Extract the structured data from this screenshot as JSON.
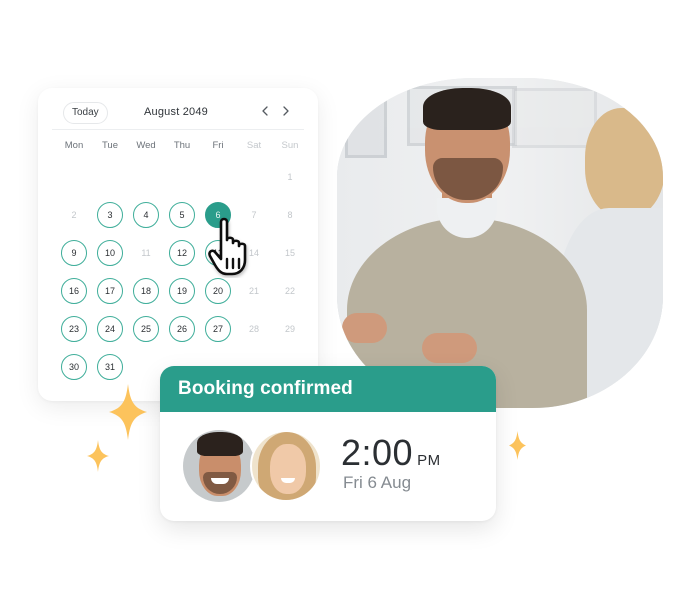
{
  "calendar": {
    "today_label": "Today",
    "month_title": "August 2049",
    "prev_icon": "chevron-left-icon",
    "next_icon": "chevron-right-icon",
    "weekdays": [
      {
        "label": "Mon",
        "weekend": false
      },
      {
        "label": "Tue",
        "weekend": false
      },
      {
        "label": "Wed",
        "weekend": false
      },
      {
        "label": "Thu",
        "weekend": false
      },
      {
        "label": "Fri",
        "weekend": false
      },
      {
        "label": "Sat",
        "weekend": true
      },
      {
        "label": "Sun",
        "weekend": true
      }
    ],
    "leading_empty_days": 6,
    "days": [
      {
        "day": "1",
        "state": "unavailable"
      },
      {
        "day": "2",
        "state": "unavailable"
      },
      {
        "day": "3",
        "state": "available"
      },
      {
        "day": "4",
        "state": "available"
      },
      {
        "day": "5",
        "state": "available"
      },
      {
        "day": "6",
        "state": "selected"
      },
      {
        "day": "7",
        "state": "unavailable"
      },
      {
        "day": "8",
        "state": "unavailable"
      },
      {
        "day": "9",
        "state": "available"
      },
      {
        "day": "10",
        "state": "available"
      },
      {
        "day": "11",
        "state": "unavailable"
      },
      {
        "day": "12",
        "state": "available"
      },
      {
        "day": "13",
        "state": "available"
      },
      {
        "day": "14",
        "state": "unavailable"
      },
      {
        "day": "15",
        "state": "unavailable"
      },
      {
        "day": "16",
        "state": "available"
      },
      {
        "day": "17",
        "state": "available"
      },
      {
        "day": "18",
        "state": "available"
      },
      {
        "day": "19",
        "state": "available"
      },
      {
        "day": "20",
        "state": "available"
      },
      {
        "day": "21",
        "state": "unavailable"
      },
      {
        "day": "22",
        "state": "unavailable"
      },
      {
        "day": "23",
        "state": "available"
      },
      {
        "day": "24",
        "state": "available"
      },
      {
        "day": "25",
        "state": "available"
      },
      {
        "day": "26",
        "state": "available"
      },
      {
        "day": "27",
        "state": "available"
      },
      {
        "day": "28",
        "state": "unavailable"
      },
      {
        "day": "29",
        "state": "unavailable"
      },
      {
        "day": "30",
        "state": "available"
      },
      {
        "day": "31",
        "state": "available"
      }
    ]
  },
  "pointer_icon": "hand-pointer-icon",
  "booking": {
    "title": "Booking confirmed",
    "time": "2:00",
    "ampm": "PM",
    "date": "Fri 6 Aug",
    "attendees": [
      "man-avatar",
      "woman-avatar"
    ]
  },
  "photo": {
    "description": "Man in beige sweater smiling in a meeting with a woman"
  },
  "colors": {
    "accent": "#2a9d8b",
    "available_ring": "#3fae9a",
    "sparkle": "#fcc35c",
    "muted_text": "#858b91"
  }
}
